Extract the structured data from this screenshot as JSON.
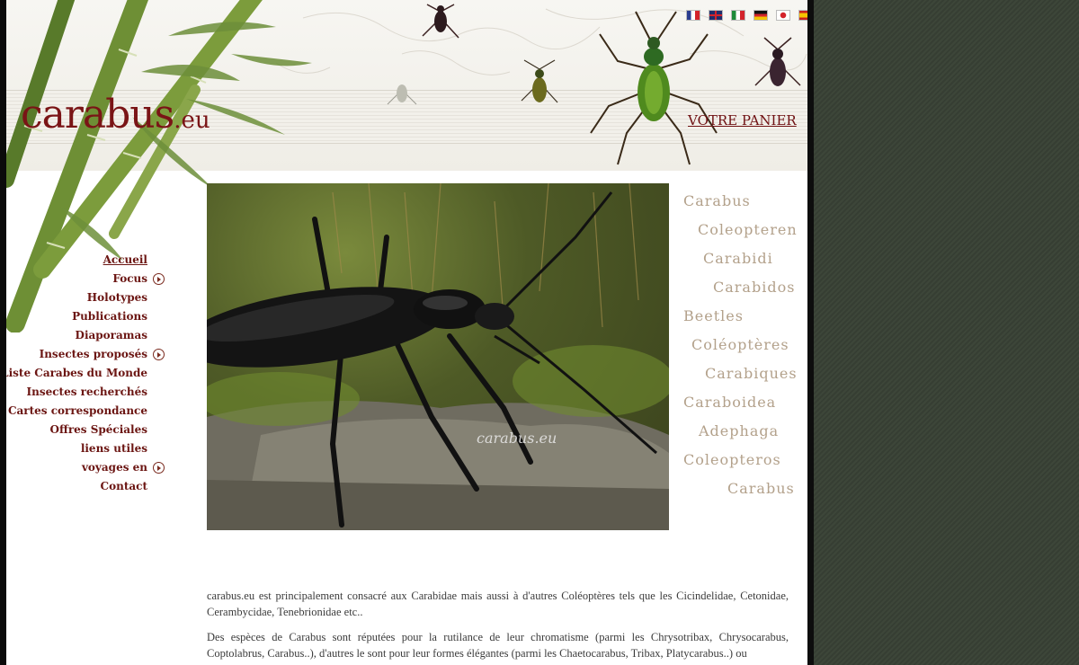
{
  "header": {
    "logo_main": "carabus",
    "logo_ext": ".eu",
    "cart_label": "VOTRE PANIER",
    "flags": [
      "french-flag-icon",
      "english-flag-icon",
      "italian-flag-icon",
      "german-flag-icon",
      "japanese-flag-icon",
      "spanish-flag-icon"
    ]
  },
  "nav": {
    "items": [
      {
        "label": "Accueil"
      },
      {
        "label": "Focus"
      },
      {
        "label": "Holotypes"
      },
      {
        "label": "Publications"
      },
      {
        "label": "Diaporamas"
      },
      {
        "label": "Insectes proposés"
      },
      {
        "label": "Liste Carabes du Monde"
      },
      {
        "label": "Insectes recherchés"
      },
      {
        "label": "Cartes correspondance"
      },
      {
        "label": "Offres Spéciales"
      },
      {
        "label": "liens utiles"
      },
      {
        "label": "voyages en"
      },
      {
        "label": "Contact"
      }
    ]
  },
  "photo": {
    "watermark": "carabus.eu"
  },
  "side_words": [
    "Carabus",
    "Coleopteren",
    "Carabidi",
    "Carabidos",
    "Beetles",
    "Coléoptères",
    "Carabiques",
    "Caraboidea",
    "Adephaga",
    "Coleopteros",
    "Carabus"
  ],
  "content": {
    "paragraph_1": "carabus.eu est principalement consacré  aux Carabidae mais aussi à d'autres Coléoptères tels que les Cicindelidae, Cetonidae, Cerambycidae, Tenebrionidae etc..",
    "paragraph_2": "Des espèces de Carabus sont réputées pour la rutilance de leur chromatisme (parmi les Chrysotribax, Chrysocarabus, Coptolabrus, Carabus..), d'autres le sont pour leur formes élégantes (parmi les Chaetocarabus, Tribax, Platycarabus..) ou"
  },
  "colors": {
    "brand_red": "#7a1416",
    "nav_text": "#6b1512",
    "side_word": "#b3a18b",
    "outer_background": "#3a4236"
  }
}
